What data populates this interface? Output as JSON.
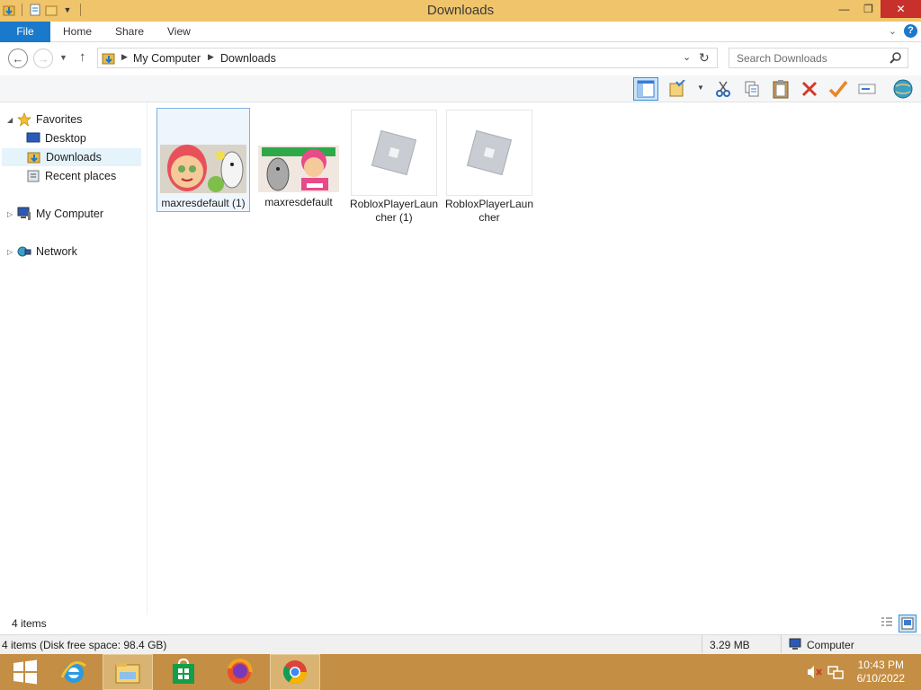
{
  "window": {
    "title": "Downloads",
    "minimize": "—",
    "maximize": "❐",
    "close": "✕"
  },
  "ribbon": {
    "file_tab": "File",
    "tabs": [
      "Home",
      "Share",
      "View"
    ],
    "help": "?"
  },
  "address": {
    "breadcrumb": [
      "My Computer",
      "Downloads"
    ],
    "search_placeholder": "Search Downloads"
  },
  "nav": {
    "favorites": "Favorites",
    "desktop": "Desktop",
    "downloads": "Downloads",
    "recent_places": "Recent places",
    "my_computer": "My Computer",
    "network": "Network"
  },
  "files": [
    {
      "name": "maxresdefault (1)",
      "type": "image",
      "selected": true
    },
    {
      "name": "maxresdefault",
      "type": "image",
      "selected": false
    },
    {
      "name": "RobloxPlayerLauncher (1)",
      "type": "exe",
      "selected": false
    },
    {
      "name": "RobloxPlayerLauncher",
      "type": "exe",
      "selected": false
    }
  ],
  "status": {
    "item_count": "4 items",
    "details": "4 items (Disk free space: 98.4 GB)",
    "size": "3.29 MB",
    "location": "Computer"
  },
  "taskbar": {
    "apps": [
      "start-icon",
      "internet-explorer-icon",
      "file-explorer-icon",
      "store-icon",
      "firefox-icon",
      "chrome-icon"
    ],
    "time": "10:43 PM",
    "date": "6/10/2022"
  },
  "colors": {
    "titlebar": "#f0c46a",
    "accent": "#1979ca",
    "taskbar": "#c48e44",
    "close": "#c7302b"
  }
}
